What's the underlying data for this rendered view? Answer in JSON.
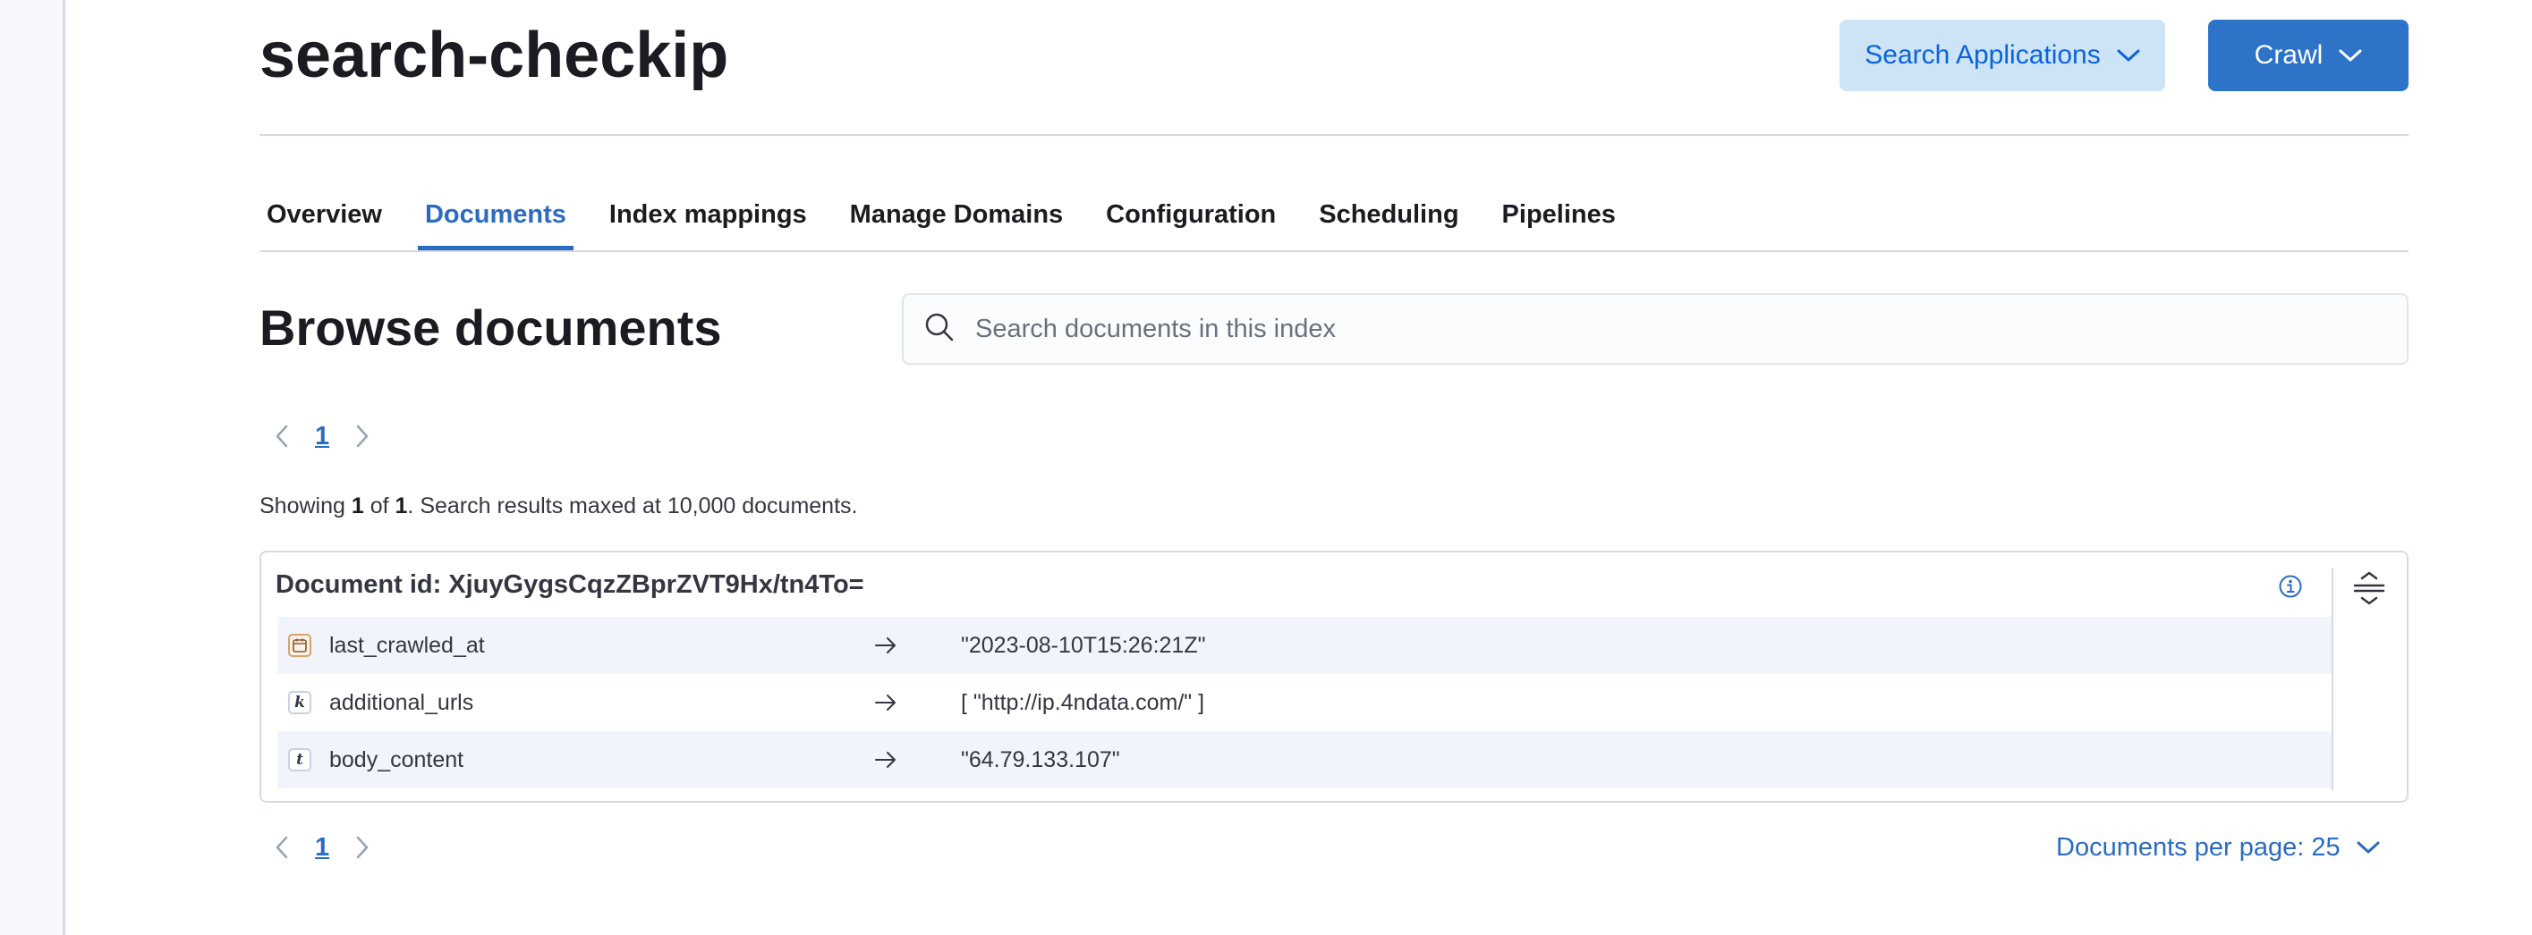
{
  "header": {
    "title": "search-checkip",
    "search_applications_label": "Search Applications",
    "crawl_label": "Crawl"
  },
  "tabs": [
    {
      "label": "Overview",
      "active": false
    },
    {
      "label": "Documents",
      "active": true
    },
    {
      "label": "Index mappings",
      "active": false
    },
    {
      "label": "Manage Domains",
      "active": false
    },
    {
      "label": "Configuration",
      "active": false
    },
    {
      "label": "Scheduling",
      "active": false
    },
    {
      "label": "Pipelines",
      "active": false
    }
  ],
  "browse": {
    "title": "Browse documents",
    "search_placeholder": "Search documents in this index",
    "search_value": ""
  },
  "pagination": {
    "current_page": "1"
  },
  "results_summary": {
    "prefix": "Showing ",
    "shown": "1",
    "of": " of ",
    "total": "1",
    "suffix": ". Search results maxed at 10,000 documents."
  },
  "document": {
    "id_label": "Document id:",
    "id_value": "XjuyGygsCqzZBprZVT9Hx/tn4To=",
    "fields": [
      {
        "type": "date",
        "type_glyph": "",
        "name": "last_crawled_at",
        "value": "\"2023-08-10T15:26:21Z\""
      },
      {
        "type": "keyword",
        "type_glyph": "k",
        "name": "additional_urls",
        "value": "[ \"http://ip.4ndata.com/\" ]"
      },
      {
        "type": "text",
        "type_glyph": "t",
        "name": "body_content",
        "value": "\"64.79.133.107\""
      }
    ]
  },
  "per_page": {
    "label": "Documents per page: 25"
  },
  "colors": {
    "accent": "#2b6bc0",
    "primary_button": "#2d74c8",
    "secondary_button": "#cce4f5",
    "border": "#d3dae6"
  },
  "icons": {
    "search": "search-icon",
    "info": "info-icon",
    "expand": "expand-rows-icon",
    "chevron": "chevron-down-icon",
    "prev": "chevron-left-icon",
    "next": "chevron-right-icon",
    "arrow": "arrow-right-icon",
    "date": "calendar-icon"
  }
}
